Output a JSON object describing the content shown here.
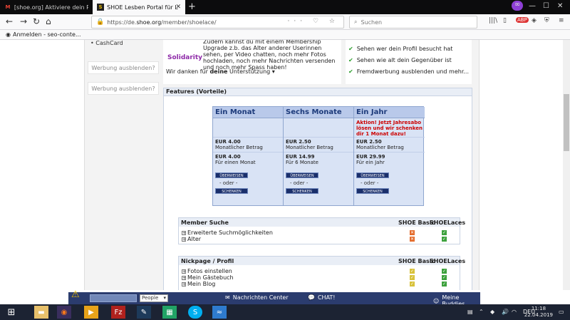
{
  "browser": {
    "tabs": [
      {
        "title": "[shoe.org] Aktiviere dein Profil",
        "fav": "M",
        "fav_color": "#ea4335"
      },
      {
        "title": "SHOE Lesben Portal für Lesben",
        "fav": "S",
        "fav_color": "#e0b400"
      }
    ],
    "new_tab": "+",
    "url_prefix": "https://de.",
    "url_host": "shoe.org",
    "url_path": "/member/shoelace/",
    "url_icons": "··· ♡ ☆",
    "search_placeholder": "Suchen",
    "bookmark": "Anmelden - seo-conte..."
  },
  "sidebar": {
    "link": "• CashCard",
    "ad_hide_1": "Werbung ausblenden?",
    "ad_hide_2": "Werbung ausblenden?"
  },
  "promo": {
    "solidarity": "Solidarity",
    "text": "Zudem kannst du mit einem Membership Upgrade z.b. das Alter anderer Userinnen sehen, per Video chatten, noch mehr Fotos hochladen, noch mehr Nachrichten versenden und noch mehr Spass haben!",
    "thanks_prefix": "Wir danken für",
    "thanks_bold": "deine",
    "thanks_suffix": "Unterstützung ▾"
  },
  "benefits": [
    "Sehen wer dein Profil besucht hat",
    "Sehen wie alt dein Gegenüber ist",
    "Fremdwerbung ausblenden und mehr..."
  ],
  "features": {
    "title": "Features (Vorteile)",
    "plans": [
      {
        "name": "Ein Monat",
        "promo": "",
        "monthly": "EUR 4.00",
        "monthly_label": "Monatlicher Betrag",
        "total": "EUR 4.00",
        "total_label": "Für einen Monat"
      },
      {
        "name": "Sechs Monate",
        "promo": "",
        "monthly": "EUR 2.50",
        "monthly_label": "Monatlicher Betrag",
        "total": "EUR 14.99",
        "total_label": "Für 6 Monate"
      },
      {
        "name": "Ein Jahr",
        "promo": "Aktion! Jetzt Jahresabo lösen und wir schenken dir 1 Monat dazu!",
        "monthly": "EUR 2.50",
        "monthly_label": "Monatlicher Betrag",
        "total": "EUR 29.99",
        "total_label": "Für ein Jahr"
      }
    ],
    "pay_label": "ÜBERWEISEN",
    "or_label": "- oder -",
    "gift_label": "SCHENKEN"
  },
  "member_search": {
    "title": "Member Suche",
    "col_basic": "SHOE Basic",
    "col_laces": "SHOELaces",
    "rows": [
      {
        "label": "Erweiterte Suchmöglichkeiten",
        "basic": "no",
        "laces": "yes"
      },
      {
        "label": "Alter",
        "basic": "no",
        "laces": "yes"
      }
    ]
  },
  "nickpage": {
    "title": "Nickpage / Profil",
    "col_basic": "SHOE Basic",
    "col_laces": "SHOELaces",
    "rows": [
      {
        "label": "Fotos einstellen",
        "basic": "part",
        "laces": "yes"
      },
      {
        "label": "Mein Gästebuch",
        "basic": "part",
        "laces": "yes"
      },
      {
        "label": "Mein Blog",
        "basic": "part",
        "laces": "yes"
      }
    ]
  },
  "chatbar": {
    "select": "People",
    "messages": "Nachrichten Center",
    "chat": "CHAT!",
    "buddies": "Meine Buddies"
  },
  "taskbar": {
    "lang": "DEU",
    "time": "11:18",
    "date": "22.04.2019"
  }
}
